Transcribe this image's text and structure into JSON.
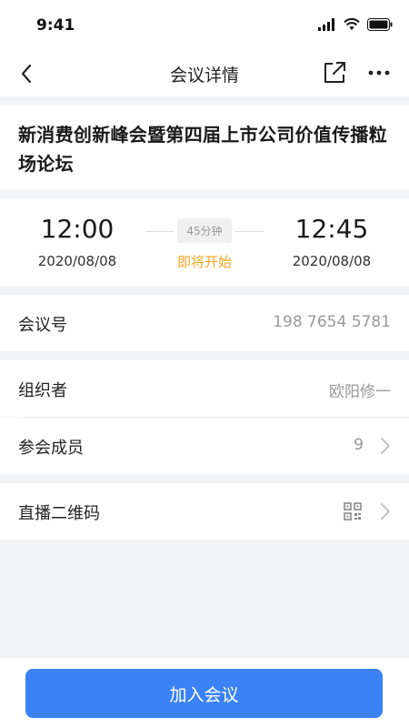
{
  "status_bar": {
    "time": "9:41"
  },
  "nav": {
    "title": "会议详情"
  },
  "meeting": {
    "title": "新消费创新峰会暨第四届上市公司价值传播粒场论坛",
    "start_time": "12:00",
    "start_date": "2020/08/08",
    "end_time": "12:45",
    "end_date": "2020/08/08",
    "duration": "45分钟",
    "status": "即将开始"
  },
  "info": {
    "meeting_id_label": "会议号",
    "meeting_id_value": "198 7654 5781",
    "organizer_label": "组织者",
    "organizer_value": "欧阳修一",
    "members_label": "参会成员",
    "members_value": "9",
    "qr_label": "直播二维码"
  },
  "actions": {
    "join_label": "加入会议"
  },
  "colors": {
    "accent": "#3b82f6",
    "status": "#f5a623"
  }
}
